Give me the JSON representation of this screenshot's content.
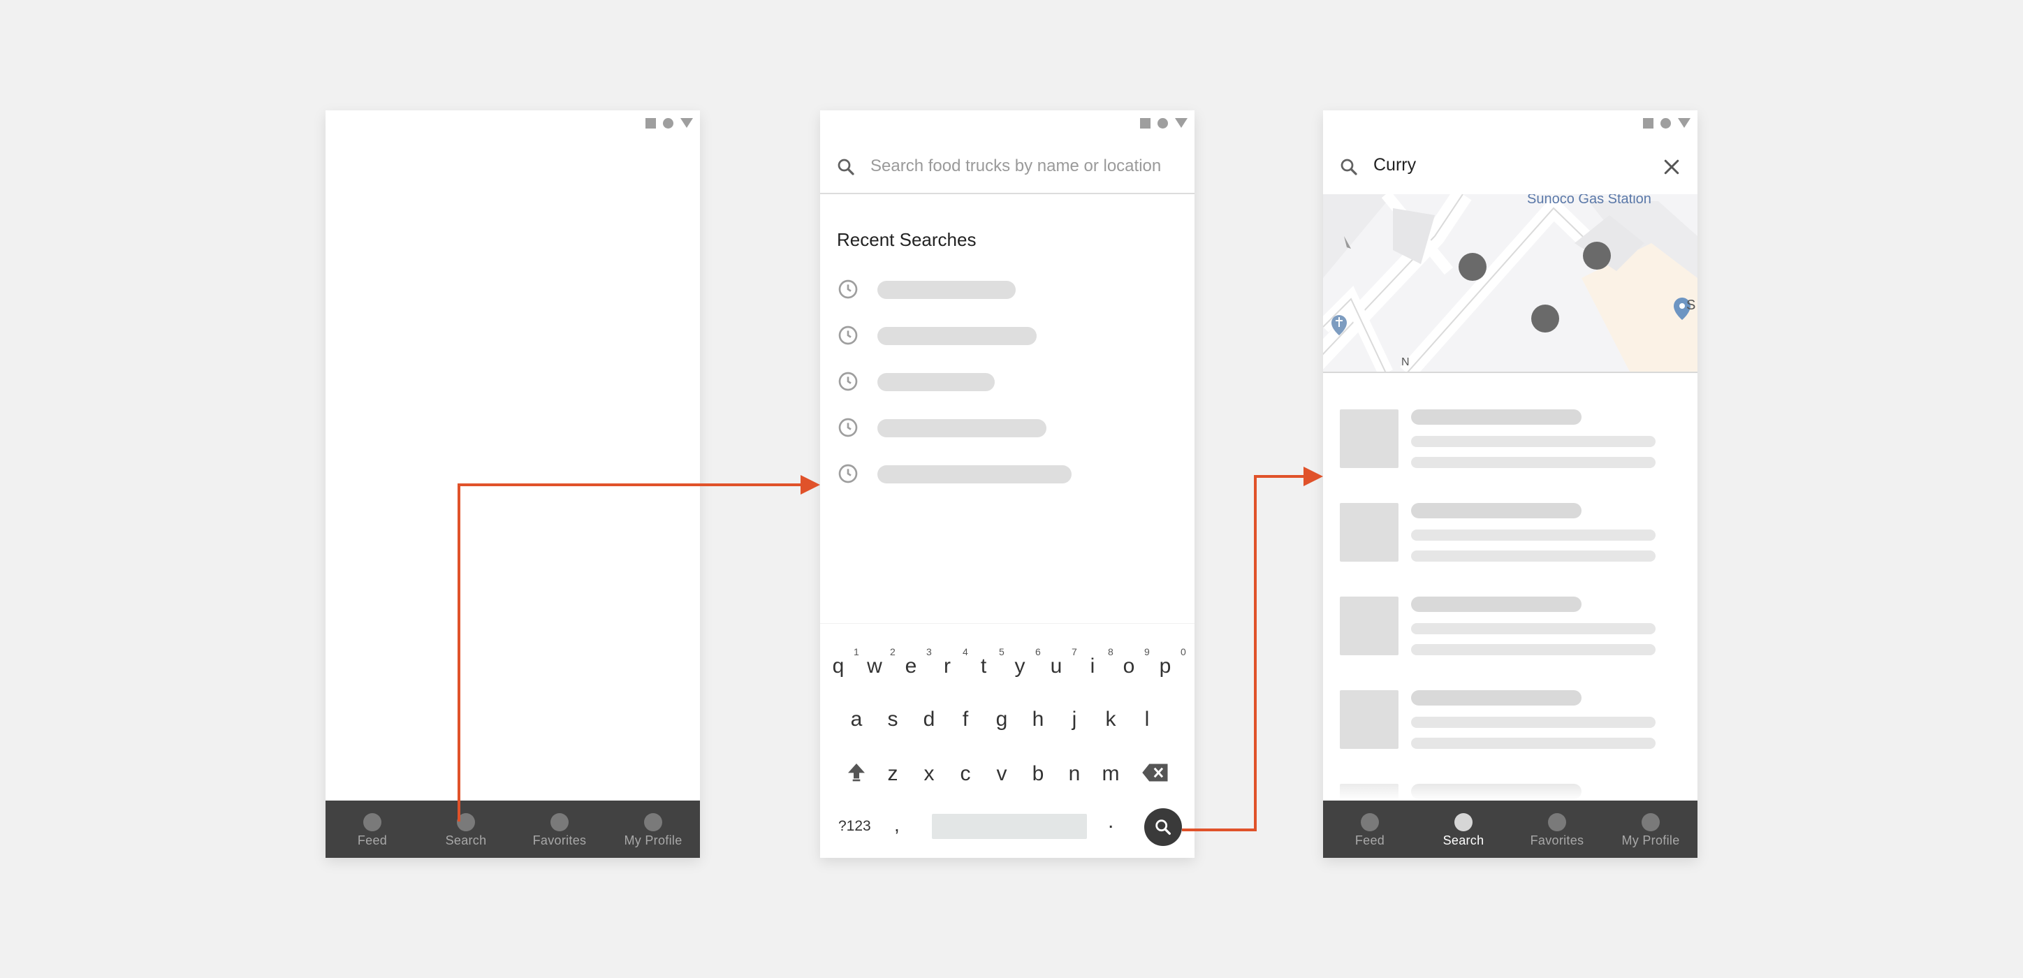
{
  "nav": {
    "items": [
      "Feed",
      "Search",
      "Favorites",
      "My Profile"
    ]
  },
  "search": {
    "placeholder": "Search food trucks by name or location",
    "query": "Curry"
  },
  "recent": {
    "title": "Recent Searches"
  },
  "keyboard": {
    "row1": [
      "q",
      "w",
      "e",
      "r",
      "t",
      "y",
      "u",
      "i",
      "o",
      "p"
    ],
    "row1_numbers": [
      "1",
      "2",
      "3",
      "4",
      "5",
      "6",
      "7",
      "8",
      "9",
      "0"
    ],
    "row2": [
      "a",
      "s",
      "d",
      "f",
      "g",
      "h",
      "j",
      "k",
      "l"
    ],
    "row3": [
      "z",
      "x",
      "c",
      "v",
      "b",
      "n",
      "m"
    ],
    "mode_label": "?123",
    "comma": ",",
    "period": "."
  },
  "map": {
    "poi_label": "Sunoco Gas Station",
    "edge_label": "S",
    "street_label": "N"
  },
  "colors": {
    "flow_arrow": "#e0522a",
    "nav_bar": "#424242",
    "skeleton": "#dedede"
  },
  "icons": [
    "search-icon",
    "close-icon",
    "clock-icon",
    "shift-icon",
    "backspace-icon",
    "map-pin-icon"
  ]
}
